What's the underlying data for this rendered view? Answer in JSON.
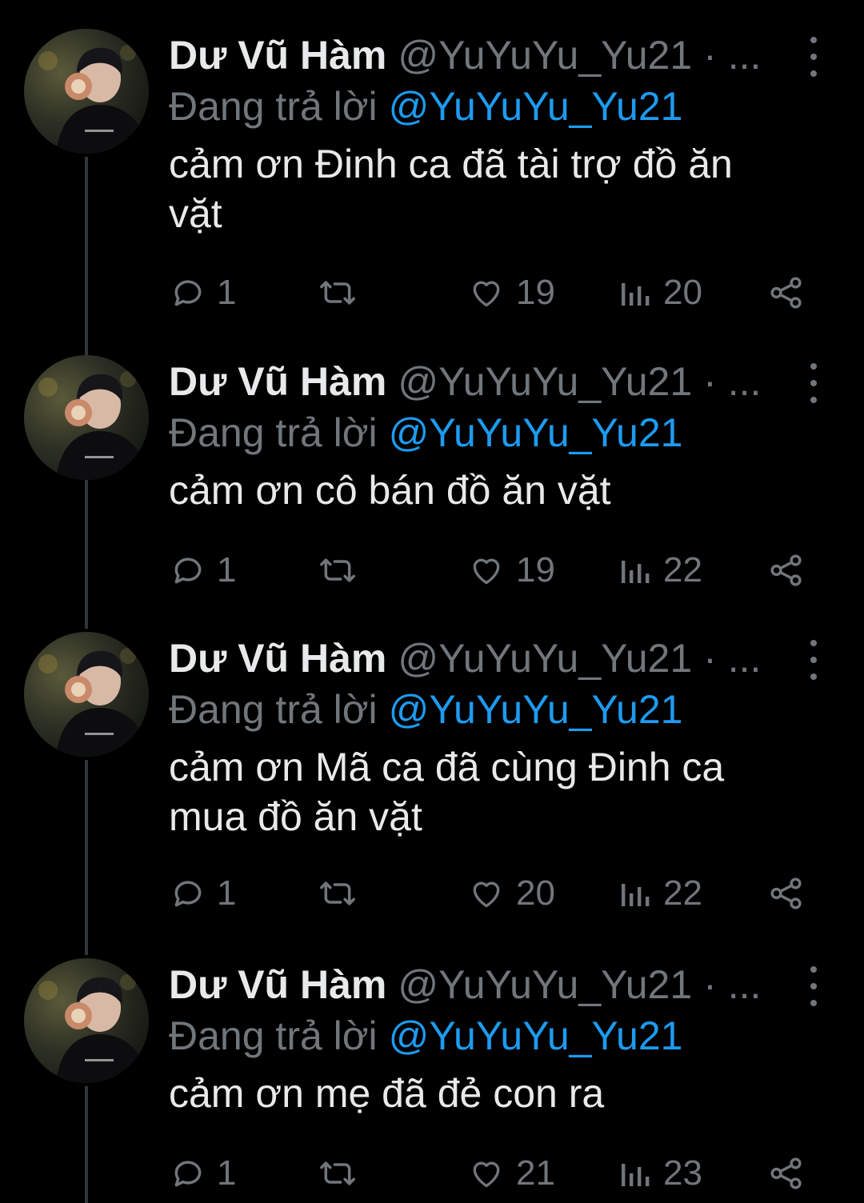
{
  "theme": {
    "background": "#000000",
    "text_primary": "#e7e9ea",
    "text_secondary": "#71767b",
    "accent": "#1d9bf0"
  },
  "tweets": [
    {
      "author_name": "Dư Vũ Hàm",
      "author_handle": "@YuYuYu_Yu21",
      "separator": "· ...",
      "reply_prefix": "Đang trả lời",
      "reply_to": "@YuYuYu_Yu21",
      "text": "cảm ơn Đinh ca đã tài trợ đồ ăn\nvặt",
      "replies": "1",
      "retweets": "",
      "likes": "19",
      "views": "20"
    },
    {
      "author_name": "Dư Vũ Hàm",
      "author_handle": "@YuYuYu_Yu21",
      "separator": "· ...",
      "reply_prefix": "Đang trả lời",
      "reply_to": "@YuYuYu_Yu21",
      "text": "cảm ơn cô bán đồ ăn vặt",
      "replies": "1",
      "retweets": "",
      "likes": "19",
      "views": "22"
    },
    {
      "author_name": "Dư Vũ Hàm",
      "author_handle": "@YuYuYu_Yu21",
      "separator": "· ...",
      "reply_prefix": "Đang trả lời",
      "reply_to": "@YuYuYu_Yu21",
      "text": "cảm ơn Mã ca đã cùng Đinh ca\nmua đồ ăn vặt",
      "replies": "1",
      "retweets": "",
      "likes": "20",
      "views": "22"
    },
    {
      "author_name": "Dư Vũ Hàm",
      "author_handle": "@YuYuYu_Yu21",
      "separator": "· ...",
      "reply_prefix": "Đang trả lời",
      "reply_to": "@YuYuYu_Yu21",
      "text": "cảm ơn mẹ đã đẻ con ra",
      "replies": "1",
      "retweets": "",
      "likes": "21",
      "views": "23"
    }
  ],
  "icons": {
    "reply": "reply-icon",
    "retweet": "retweet-icon",
    "like": "heart-icon",
    "views": "views-icon",
    "share": "share-icon",
    "more": "more-vertical-icon"
  }
}
